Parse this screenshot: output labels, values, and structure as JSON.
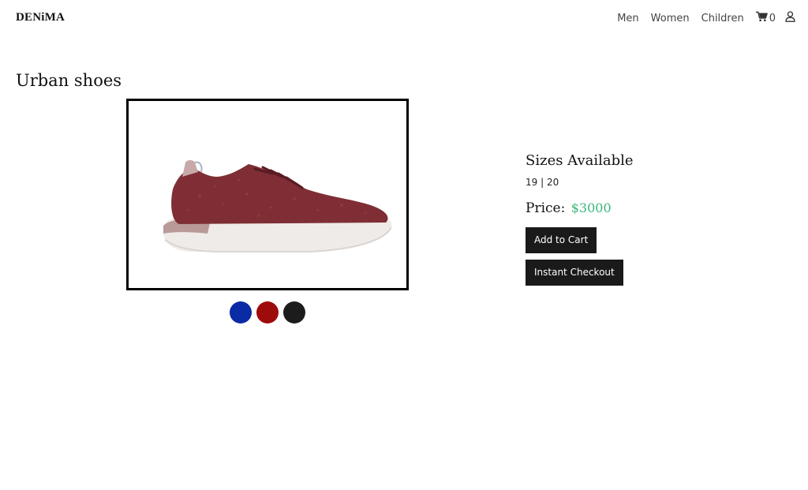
{
  "header": {
    "brand": "DENiMA",
    "nav": [
      {
        "label": "Men"
      },
      {
        "label": "Women"
      },
      {
        "label": "Children"
      }
    ],
    "cart_count": "0",
    "icons": {
      "cart": "cart-icon",
      "user": "user-icon"
    }
  },
  "product": {
    "title": "Urban shoes",
    "image_alt": "shoe-image",
    "colors": [
      {
        "name": "blue",
        "hex": "#0a2aa6"
      },
      {
        "name": "red",
        "hex": "#9e0b0b"
      },
      {
        "name": "black",
        "hex": "#1c1c1c"
      }
    ],
    "sizes_heading": "Sizes Available",
    "sizes": "19 | 20",
    "price_label": "Price:",
    "price_value": "$3000",
    "add_to_cart": "Add to Cart",
    "instant_checkout": "Instant Checkout"
  },
  "theme": {
    "accent_price": "#3bb77a",
    "button_bg": "#1a1a1a"
  }
}
